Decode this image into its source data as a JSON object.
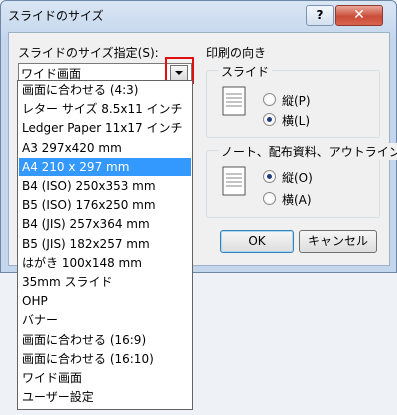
{
  "window": {
    "title": "スライドのサイズ",
    "help_label": "?",
    "close_label": "✕"
  },
  "slide_size": {
    "label": "スライドのサイズ指定(S):",
    "selected_value": "ワイド画面",
    "options": [
      {
        "label": "画面に合わせる (4:3)",
        "selected": false
      },
      {
        "label": "レター サイズ 8.5x11 インチ",
        "selected": false
      },
      {
        "label": "Ledger Paper 11x17 インチ",
        "selected": false
      },
      {
        "label": "A3 297x420 mm",
        "selected": false
      },
      {
        "label": "A4 210 x 297 mm",
        "selected": true
      },
      {
        "label": "B4 (ISO) 250x353 mm",
        "selected": false
      },
      {
        "label": "B5 (ISO) 176x250 mm",
        "selected": false
      },
      {
        "label": "B4 (JIS) 257x364 mm",
        "selected": false
      },
      {
        "label": "B5 (JIS) 182x257 mm",
        "selected": false
      },
      {
        "label": "はがき 100x148 mm",
        "selected": false
      },
      {
        "label": "35mm スライド",
        "selected": false
      },
      {
        "label": "OHP",
        "selected": false
      },
      {
        "label": "バナー",
        "selected": false
      },
      {
        "label": "画面に合わせる (16:9)",
        "selected": false
      },
      {
        "label": "画面に合わせる (16:10)",
        "selected": false
      },
      {
        "label": "ワイド画面",
        "selected": false
      },
      {
        "label": "ユーザー設定",
        "selected": false
      }
    ]
  },
  "orientation": {
    "group_label": "印刷の向き",
    "slides": {
      "label": "スライド",
      "portrait_label": "縦(P)",
      "landscape_label": "横(L)",
      "selected": "landscape"
    },
    "notes": {
      "label": "ノート、配布資料、アウトライン",
      "portrait_label": "縦(O)",
      "landscape_label": "横(A)",
      "selected": "portrait"
    }
  },
  "buttons": {
    "ok": "OK",
    "cancel": "キャンセル"
  },
  "icons": {
    "help": "help-icon",
    "close": "close-icon",
    "dropdown": "chevron-down-icon",
    "slide_doc": "document-icon"
  }
}
